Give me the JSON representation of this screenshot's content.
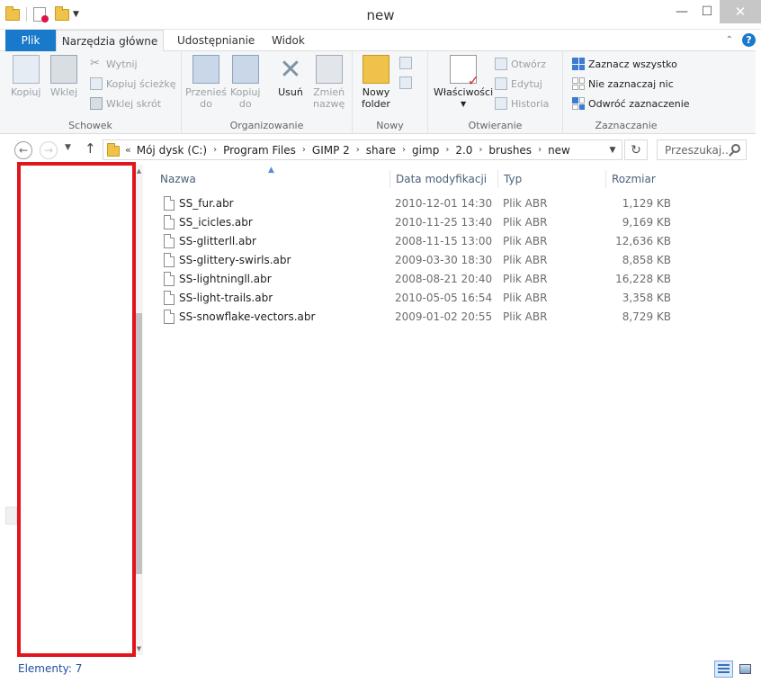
{
  "window": {
    "title": "new"
  },
  "ribbon": {
    "tabs": [
      {
        "label": "Plik"
      },
      {
        "label": "Narzędzia główne"
      },
      {
        "label": "Udostępnianie"
      },
      {
        "label": "Widok"
      }
    ],
    "groups": {
      "schowek": {
        "label": "Schowek",
        "copy": "Kopiuj",
        "paste": "Wklej",
        "cut": "Wytnij",
        "copy_path": "Kopiuj ścieżkę",
        "paste_shortcut": "Wklej skrót"
      },
      "organizowanie": {
        "label": "Organizowanie",
        "move_to_1": "Przenieś",
        "move_to_2": "do",
        "copy_to_1": "Kopiuj",
        "copy_to_2": "do",
        "delete": "Usuń",
        "rename_1": "Zmień",
        "rename_2": "nazwę"
      },
      "nowy": {
        "label": "Nowy",
        "new_folder_1": "Nowy",
        "new_folder_2": "folder"
      },
      "otwieranie": {
        "label": "Otwieranie",
        "properties": "Właściwości",
        "open": "Otwórz",
        "edit": "Edytuj",
        "history": "Historia"
      },
      "zaznaczanie": {
        "label": "Zaznaczanie",
        "select_all": "Zaznacz wszystko",
        "select_none": "Nie zaznaczaj nic",
        "invert": "Odwróć zaznaczenie"
      }
    }
  },
  "address": {
    "crumbs": [
      "Mój dysk (C:)",
      "Program Files",
      "GIMP 2",
      "share",
      "gimp",
      "2.0",
      "brushes",
      "new"
    ]
  },
  "search": {
    "placeholder": "Przeszukaj..."
  },
  "filelist": {
    "columns": [
      "Nazwa",
      "Data modyfikacji",
      "Typ",
      "Rozmiar"
    ],
    "rows": [
      {
        "name": "SS_fur.abr",
        "date": "2010-12-01 14:30",
        "type": "Plik ABR",
        "size": "1,129 KB"
      },
      {
        "name": "SS_icicles.abr",
        "date": "2010-11-25 13:40",
        "type": "Plik ABR",
        "size": "9,169 KB"
      },
      {
        "name": "SS-glitterll.abr",
        "date": "2008-11-15 13:00",
        "type": "Plik ABR",
        "size": "12,636 KB"
      },
      {
        "name": "SS-glittery-swirls.abr",
        "date": "2009-03-30 18:30",
        "type": "Plik ABR",
        "size": "8,858 KB"
      },
      {
        "name": "SS-lightningll.abr",
        "date": "2008-08-21 20:40",
        "type": "Plik ABR",
        "size": "16,228 KB"
      },
      {
        "name": "SS-light-trails.abr",
        "date": "2010-05-05 16:54",
        "type": "Plik ABR",
        "size": "3,358 KB"
      },
      {
        "name": "SS-snowflake-vectors.abr",
        "date": "2009-01-02 20:55",
        "type": "Plik ABR",
        "size": "8,729 KB"
      }
    ]
  },
  "status": {
    "items": "Elementy: 7"
  },
  "colors": {
    "accent": "#1979ca",
    "highlight": "#e2141c"
  }
}
